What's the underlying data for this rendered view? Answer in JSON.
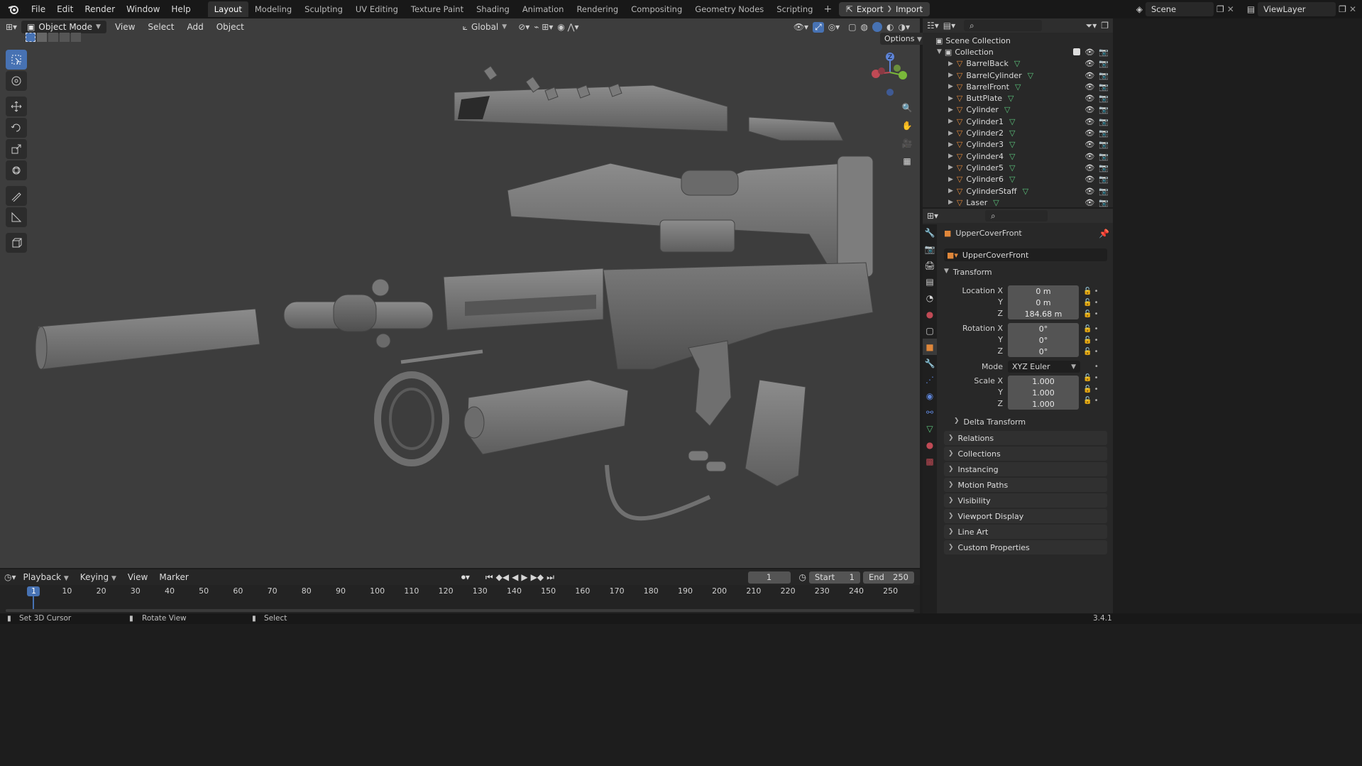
{
  "topbar": {
    "menus": [
      "File",
      "Edit",
      "Render",
      "Window",
      "Help"
    ],
    "workspaces": [
      "Layout",
      "Modeling",
      "Sculpting",
      "UV Editing",
      "Texture Paint",
      "Shading",
      "Animation",
      "Rendering",
      "Compositing",
      "Geometry Nodes",
      "Scripting"
    ],
    "plus": "+",
    "export_label": "Export",
    "import_label": "Import",
    "scene_name": "Scene",
    "view_layer": "ViewLayer"
  },
  "viewport": {
    "mode": "Object Mode",
    "menus": [
      "View",
      "Select",
      "Add",
      "Object"
    ],
    "orientation": "Global",
    "options_label": "Options",
    "gizmo_z": "Z"
  },
  "outliner": {
    "root": "Scene Collection",
    "collection": "Collection",
    "items": [
      "BarrelBack",
      "BarrelCylinder",
      "BarrelFront",
      "ButtPlate",
      "Cylinder",
      "Cylinder1",
      "Cylinder2",
      "Cylinder3",
      "Cylinder4",
      "Cylinder5",
      "Cylinder6",
      "CylinderStaff",
      "Laser"
    ]
  },
  "properties": {
    "object_name": "UpperCoverFront",
    "object_field": "UpperCoverFront",
    "transform_title": "Transform",
    "location_label": "Location X",
    "rotation_label": "Rotation X",
    "scale_label": "Scale X",
    "y_label": "Y",
    "z_label": "Z",
    "location": [
      "0 m",
      "0 m",
      "184.68 m"
    ],
    "rotation": [
      "0°",
      "0°",
      "0°"
    ],
    "mode_label": "Mode",
    "mode_value": "XYZ Euler",
    "scale": [
      "1.000",
      "1.000",
      "1.000"
    ],
    "delta": "Delta Transform",
    "sections": [
      "Relations",
      "Collections",
      "Instancing",
      "Motion Paths",
      "Visibility",
      "Viewport Display",
      "Line Art",
      "Custom Properties"
    ]
  },
  "timeline": {
    "menus": [
      "Playback",
      "Keying",
      "View",
      "Marker"
    ],
    "current_frame": "1",
    "start_label": "Start",
    "start_value": "1",
    "end_label": "End",
    "end_value": "250",
    "ticks": [
      "1",
      "10",
      "20",
      "30",
      "40",
      "50",
      "60",
      "70",
      "80",
      "90",
      "100",
      "110",
      "120",
      "130",
      "140",
      "150",
      "160",
      "170",
      "180",
      "190",
      "200",
      "210",
      "220",
      "230",
      "240",
      "250"
    ]
  },
  "status": {
    "left": "Set 3D Cursor",
    "middle": "Rotate View",
    "right": "Select",
    "version": "3.4.1"
  },
  "colors": {
    "accent": "#4772b3",
    "mesh_icon": "#e0873a",
    "vertex_green": "#5cc47c"
  }
}
